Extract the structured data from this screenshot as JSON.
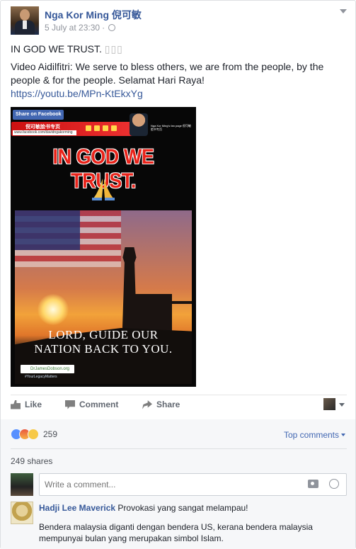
{
  "post": {
    "author": "Nga Kor Ming 倪可敏",
    "timestamp": "5 July at 23:30",
    "line1": "IN GOD WE TRUST.",
    "line1_glyphs": "▯▯▯",
    "body": "Video Aidilfitri: We serve to bless others, we are from the people, by the people & for the people. Selamat Hari Raya!",
    "link": "https://youtu.be/MPn-KtEkxYg"
  },
  "image": {
    "share_button": "Share on Facebook",
    "banner_cn": "倪可敏脸书专页",
    "banner_url": "www.facebook.com/davidngakorming",
    "banner_side": "Nga Kor Ming's fan page 倪可敏脸书专页",
    "headline": "IN GOD WE TRUST.",
    "caption_line1": "LORD, GUIDE OUR",
    "caption_line2": "NATION BACK TO YOU.",
    "dobson_label": "DrJamesDobson.org",
    "hashtag": "#YourLegacyMatters"
  },
  "actions": {
    "like": "Like",
    "comment": "Comment",
    "share": "Share"
  },
  "reactions": {
    "count": "259",
    "types": [
      "like",
      "angry",
      "haha"
    ],
    "top_comments": "Top comments"
  },
  "shares": "249 shares",
  "comment_box": {
    "placeholder": "Write a comment..."
  },
  "reply": {
    "name": "Hadji Lee Maverick",
    "first_line": "Provokasi yang sangat melampau!",
    "text": "Bendera malaysia diganti dengan bendera US, kerana bendera malaysia mempunyai bulan yang merupakan simbol Islam."
  },
  "colors": {
    "link": "#365899",
    "brand_blue": "#4267b2",
    "headline_red": "#e8231a"
  }
}
